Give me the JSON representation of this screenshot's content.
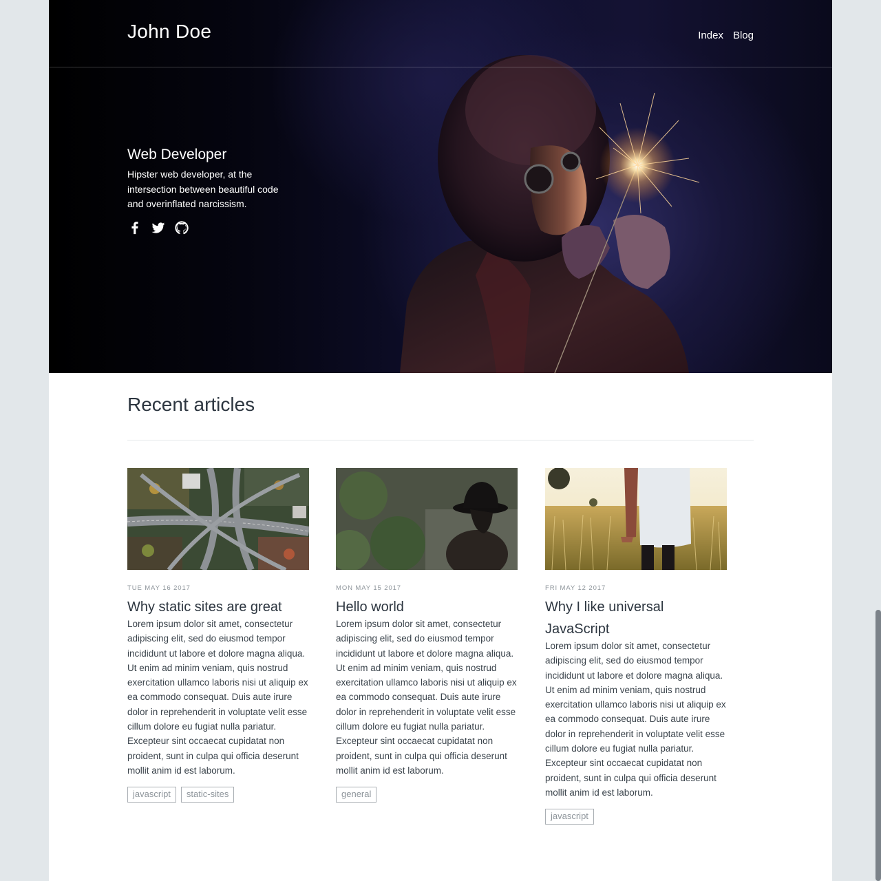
{
  "header": {
    "brand": "John Doe",
    "nav": [
      {
        "label": "Index"
      },
      {
        "label": "Blog"
      }
    ]
  },
  "hero": {
    "title": "Web Developer",
    "description": "Hipster web developer, at the intersection between beautiful code and overinflated narcissism.",
    "social": [
      {
        "icon": "facebook-icon"
      },
      {
        "icon": "twitter-icon"
      },
      {
        "icon": "github-icon"
      }
    ]
  },
  "articles_section": {
    "title": "Recent articles",
    "articles": [
      {
        "date": "TUE MAY 16 2017",
        "title": "Why static sites are great",
        "excerpt": "Lorem ipsum dolor sit amet, consectetur adipiscing elit, sed do eiusmod tempor incididunt ut labore et dolore magna aliqua. Ut enim ad minim veniam, quis nostrud exercitation ullamco laboris nisi ut aliquip ex ea commodo consequat. Duis aute irure dolor in reprehenderit in voluptate velit esse cillum dolore eu fugiat nulla pariatur. Excepteur sint occaecat cupidatat non proident, sunt in culpa qui officia deserunt mollit anim id est laborum.",
        "tags": [
          "javascript",
          "static-sites"
        ]
      },
      {
        "date": "MON MAY 15 2017",
        "title": "Hello world",
        "excerpt": "Lorem ipsum dolor sit amet, consectetur adipiscing elit, sed do eiusmod tempor incididunt ut labore et dolore magna aliqua. Ut enim ad minim veniam, quis nostrud exercitation ullamco laboris nisi ut aliquip ex ea commodo consequat. Duis aute irure dolor in reprehenderit in voluptate velit esse cillum dolore eu fugiat nulla pariatur. Excepteur sint occaecat cupidatat non proident, sunt in culpa qui officia deserunt mollit anim id est laborum.",
        "tags": [
          "general"
        ]
      },
      {
        "date": "FRI MAY 12 2017",
        "title": "Why I like universal JavaScript",
        "excerpt": "Lorem ipsum dolor sit amet, consectetur adipiscing elit, sed do eiusmod tempor incididunt ut labore et dolore magna aliqua. Ut enim ad minim veniam, quis nostrud exercitation ullamco laboris nisi ut aliquip ex ea commodo consequat. Duis aute irure dolor in reprehenderit in voluptate velit esse cillum dolore eu fugiat nulla pariatur. Excepteur sint occaecat cupidatat non proident, sunt in culpa qui officia deserunt mollit anim id est laborum.",
        "tags": [
          "javascript"
        ]
      }
    ]
  }
}
